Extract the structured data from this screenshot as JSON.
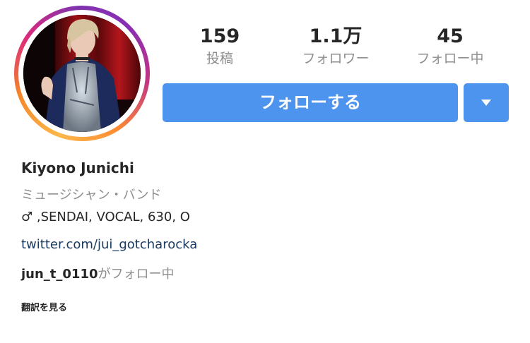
{
  "profile": {
    "avatar_icon": "profile-photo",
    "ring_colors": [
      "#fdb74a",
      "#f58529",
      "#dd2a7b",
      "#8134af"
    ]
  },
  "stats": {
    "posts_value": "159",
    "posts_label": "投稿",
    "followers_value": "1.1万",
    "followers_label": "フォロワー",
    "following_value": "45",
    "following_label": "フォロー中"
  },
  "actions": {
    "follow_label": "フォローする",
    "dropdown_icon": "caret-down-icon",
    "accent_color": "#4d94ee"
  },
  "bio": {
    "name": "Kiyono Junichi",
    "category": "ミュージシャン・バンド",
    "text": "♂ ,SENDAI, VOCAL, 630, O",
    "link": "twitter.com/jui_gotcharocka",
    "followed_by_user": "jun_t_0110",
    "followed_by_text": "がフォロー中",
    "see_translation": "翻訳を見る"
  }
}
